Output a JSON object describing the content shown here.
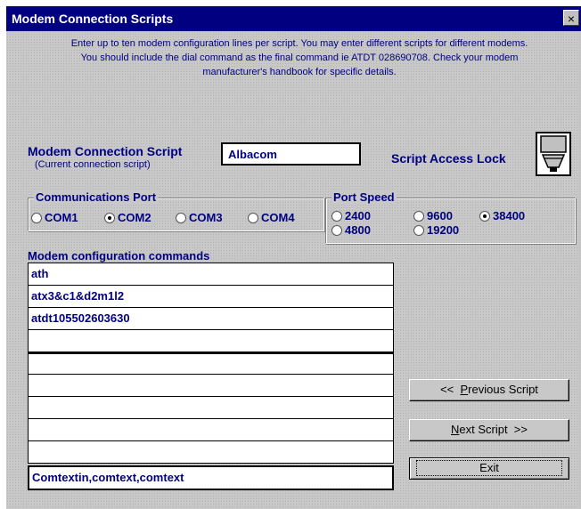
{
  "window": {
    "title": "Modem Connection Scripts",
    "close_icon": "×"
  },
  "intro": {
    "line1": "Enter up to ten modem configuration lines per script. You may enter different scripts for different modems.",
    "line2": "You should include the dial command as the final command ie ATDT 028690708. Check your modem",
    "line3": "manufacturer's handbook for specific details."
  },
  "script": {
    "label": "Modem Connection Script",
    "sublabel": "(Current connection script)",
    "value": "Albacom",
    "lock_label": "Script Access Lock",
    "lock_icon": "lock-switch-icon"
  },
  "comm_port": {
    "title": "Communications Port",
    "options": [
      "COM1",
      "COM2",
      "COM3",
      "COM4"
    ],
    "selected": "COM2"
  },
  "port_speed": {
    "title": "Port Speed",
    "options": [
      "2400",
      "9600",
      "38400",
      "4800",
      "19200"
    ],
    "selected": "38400"
  },
  "config": {
    "label": "Modem configuration commands",
    "commands": [
      "ath",
      "atx3&c1&d2m1l2",
      "atdt105502603630",
      "",
      "",
      "",
      "",
      "",
      ""
    ],
    "footer": "Comtextin,comtext,comtext"
  },
  "buttons": {
    "previous": {
      "prefix": "<<  ",
      "underline": "P",
      "rest": "revious Script"
    },
    "next": {
      "underline": "N",
      "rest": "ext Script  >>"
    },
    "exit": "Exit"
  }
}
